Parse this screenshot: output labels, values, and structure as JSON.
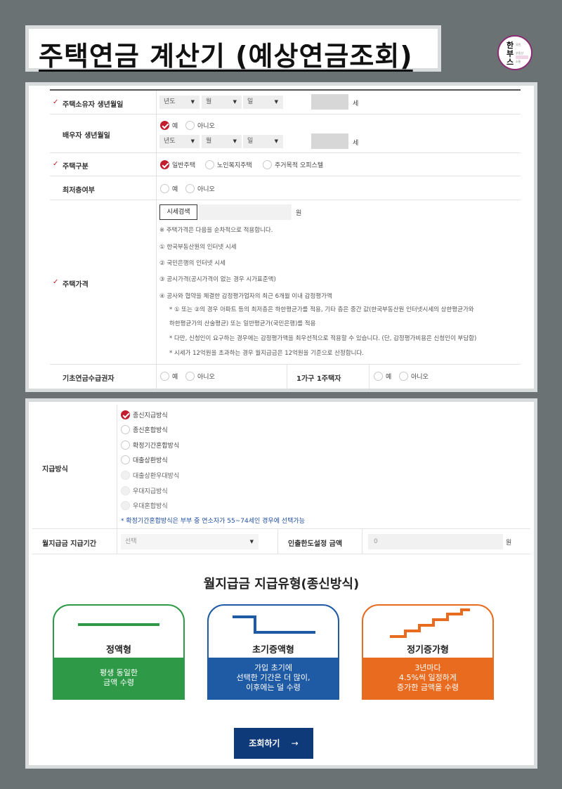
{
  "title": "주택연금 계산기 (예상연금조회)",
  "logo": {
    "line1": "한",
    "line2": "부",
    "line3": "스",
    "sub1": "국민",
    "sub2": "부동산",
    "sub3": "소통"
  },
  "birth": {
    "label": "주택소유자 생년월일",
    "year": "년도",
    "month": "월",
    "day": "일",
    "unit": "세"
  },
  "spouse": {
    "label": "배우자 생년월일",
    "yes": "예",
    "no": "아니오",
    "year": "년도",
    "month": "월",
    "day": "일",
    "unit": "세"
  },
  "housetype": {
    "label": "주택구분",
    "opt1": "일반주택",
    "opt2": "노인복지주택",
    "opt3": "주거목적 오피스텔"
  },
  "lowfloor": {
    "label": "최저층여부",
    "yes": "예",
    "no": "아니오"
  },
  "price": {
    "label": "주택가격",
    "search_button": "시세검색",
    "unit": "원",
    "note0": "※ 주택가격은 다음을 순차적으로 적용합니다.",
    "item1": "① 한국부동산원의 인터넷 시세",
    "item2": "② 국민은행의 인터넷 시세",
    "item3": "③ 공시가격(공시가격이 없는 경우 시가표준액)",
    "item4": "④ 공사와 협약을 체결한 감정평가업자의 최근 6개월 이내 감정평가액",
    "note1a": "* ① 또는 ②의 경우 아파트 등의 최저층은 하한평균가를 적용, 기타 층은 중간 값(한국부동산원 인터넷시세의 상한평균가와",
    "note1b": "하한평균가의 산술평균) 또는 일반평균가(국민은행)를 적용",
    "note2": "* 다만, 신청인이 요구하는 경우에는 감정평가액을 최우선적으로 적용할 수 있습니다. (단, 감정평가비용은 신청인이 부담함)",
    "note3": "* 시세가 12억원을 초과하는 경우 월지급금은 12억원을 기준으로 산정합니다."
  },
  "basic_pension": {
    "label": "기초연금수급권자",
    "yes": "예",
    "no": "아니오"
  },
  "one_house": {
    "label": "1가구 1주택자",
    "yes": "예",
    "no": "아니오"
  },
  "payment": {
    "label": "지급방식",
    "options": [
      "종신지급방식",
      "종신혼합방식",
      "확정기간혼합방식",
      "대출상환방식",
      "대출상환우대방식",
      "우대지급방식",
      "우대혼합방식"
    ],
    "note": "* 확정기간혼합방식은 부부 중 연소자가 55~74세인 경우에 선택가능"
  },
  "period": {
    "label": "월지급금 지급기간",
    "placeholder": "선택"
  },
  "withdraw": {
    "label": "인출한도설정 금액",
    "value": "0",
    "unit": "원"
  },
  "types": {
    "title": "월지급금 지급유형(종신방식)",
    "cards": [
      {
        "title": "정액형",
        "line1": "평생 동일한",
        "line2": "금액 수령",
        "line3": ""
      },
      {
        "title": "초기증액형",
        "line1": "가입 초기에",
        "line2": "선택한 기간은 더 많이,",
        "line3": "이후에는 덜 수령"
      },
      {
        "title": "정기증가형",
        "line1": "3년마다",
        "line2": "4.5%씩 일정하게",
        "line3": "증가한 금액을 수령"
      }
    ],
    "colors": {
      "green": "#2e9a47",
      "blue": "#1f5aa5",
      "orange": "#e86b1f"
    }
  },
  "submit": {
    "label": "조회하기",
    "arrow": "→"
  }
}
